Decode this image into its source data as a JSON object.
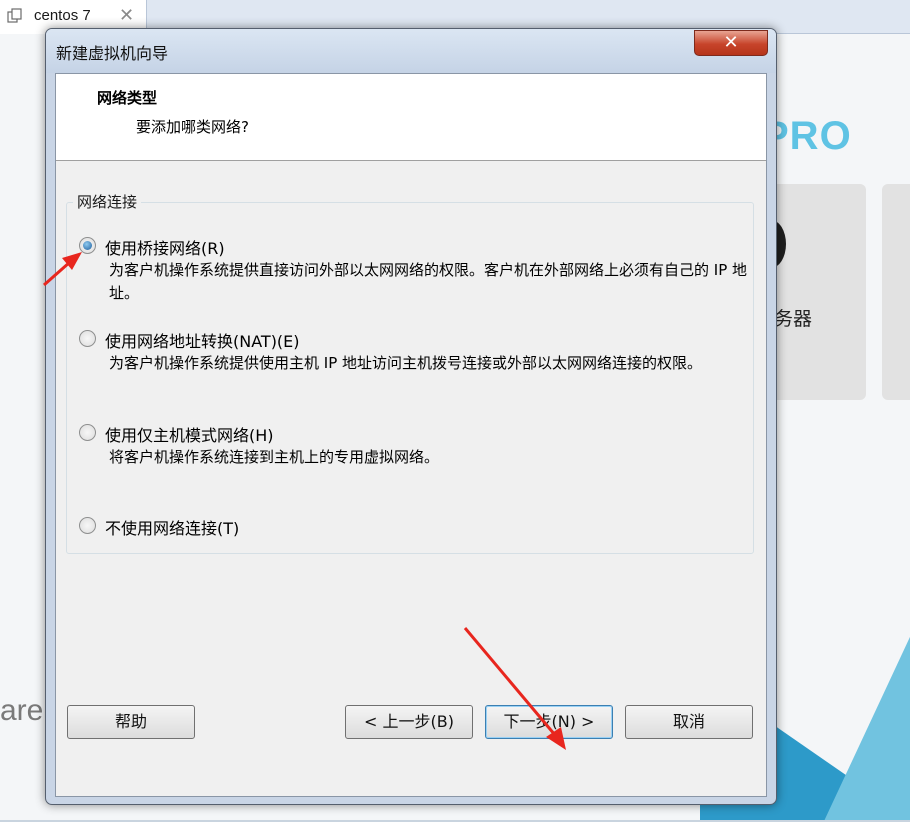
{
  "background": {
    "tab": {
      "label": "centos 7",
      "close_glyph": "✕"
    },
    "logo_text": "PRO",
    "card_text": "务器",
    "bottom_text": "are"
  },
  "dialog": {
    "title": "新建虚拟机向导",
    "close_glyph": "✕",
    "header": {
      "title": "网络类型",
      "subtitle": "要添加哪类网络?"
    },
    "group_label": "网络连接",
    "options": [
      {
        "label": "使用桥接网络(R)",
        "description": "为客户机操作系统提供直接访问外部以太网网络的权限。客户机在外部网络上必须有自己的 IP 地址。",
        "checked": true
      },
      {
        "label": "使用网络地址转换(NAT)(E)",
        "description": "为客户机操作系统提供使用主机 IP 地址访问主机拨号连接或外部以太网网络连接的权限。",
        "checked": false
      },
      {
        "label": "使用仅主机模式网络(H)",
        "description": "将客户机操作系统连接到主机上的专用虚拟网络。",
        "checked": false
      },
      {
        "label": "不使用网络连接(T)",
        "description": "",
        "checked": false
      }
    ],
    "buttons": {
      "help": "帮助",
      "back": "< 上一步(B)",
      "next": "下一步(N) >",
      "cancel": "取消"
    }
  },
  "colors": {
    "annotation_arrow": "#e8261e",
    "radio_checked": "#1d5d9c",
    "close_button": "#c7442b"
  }
}
